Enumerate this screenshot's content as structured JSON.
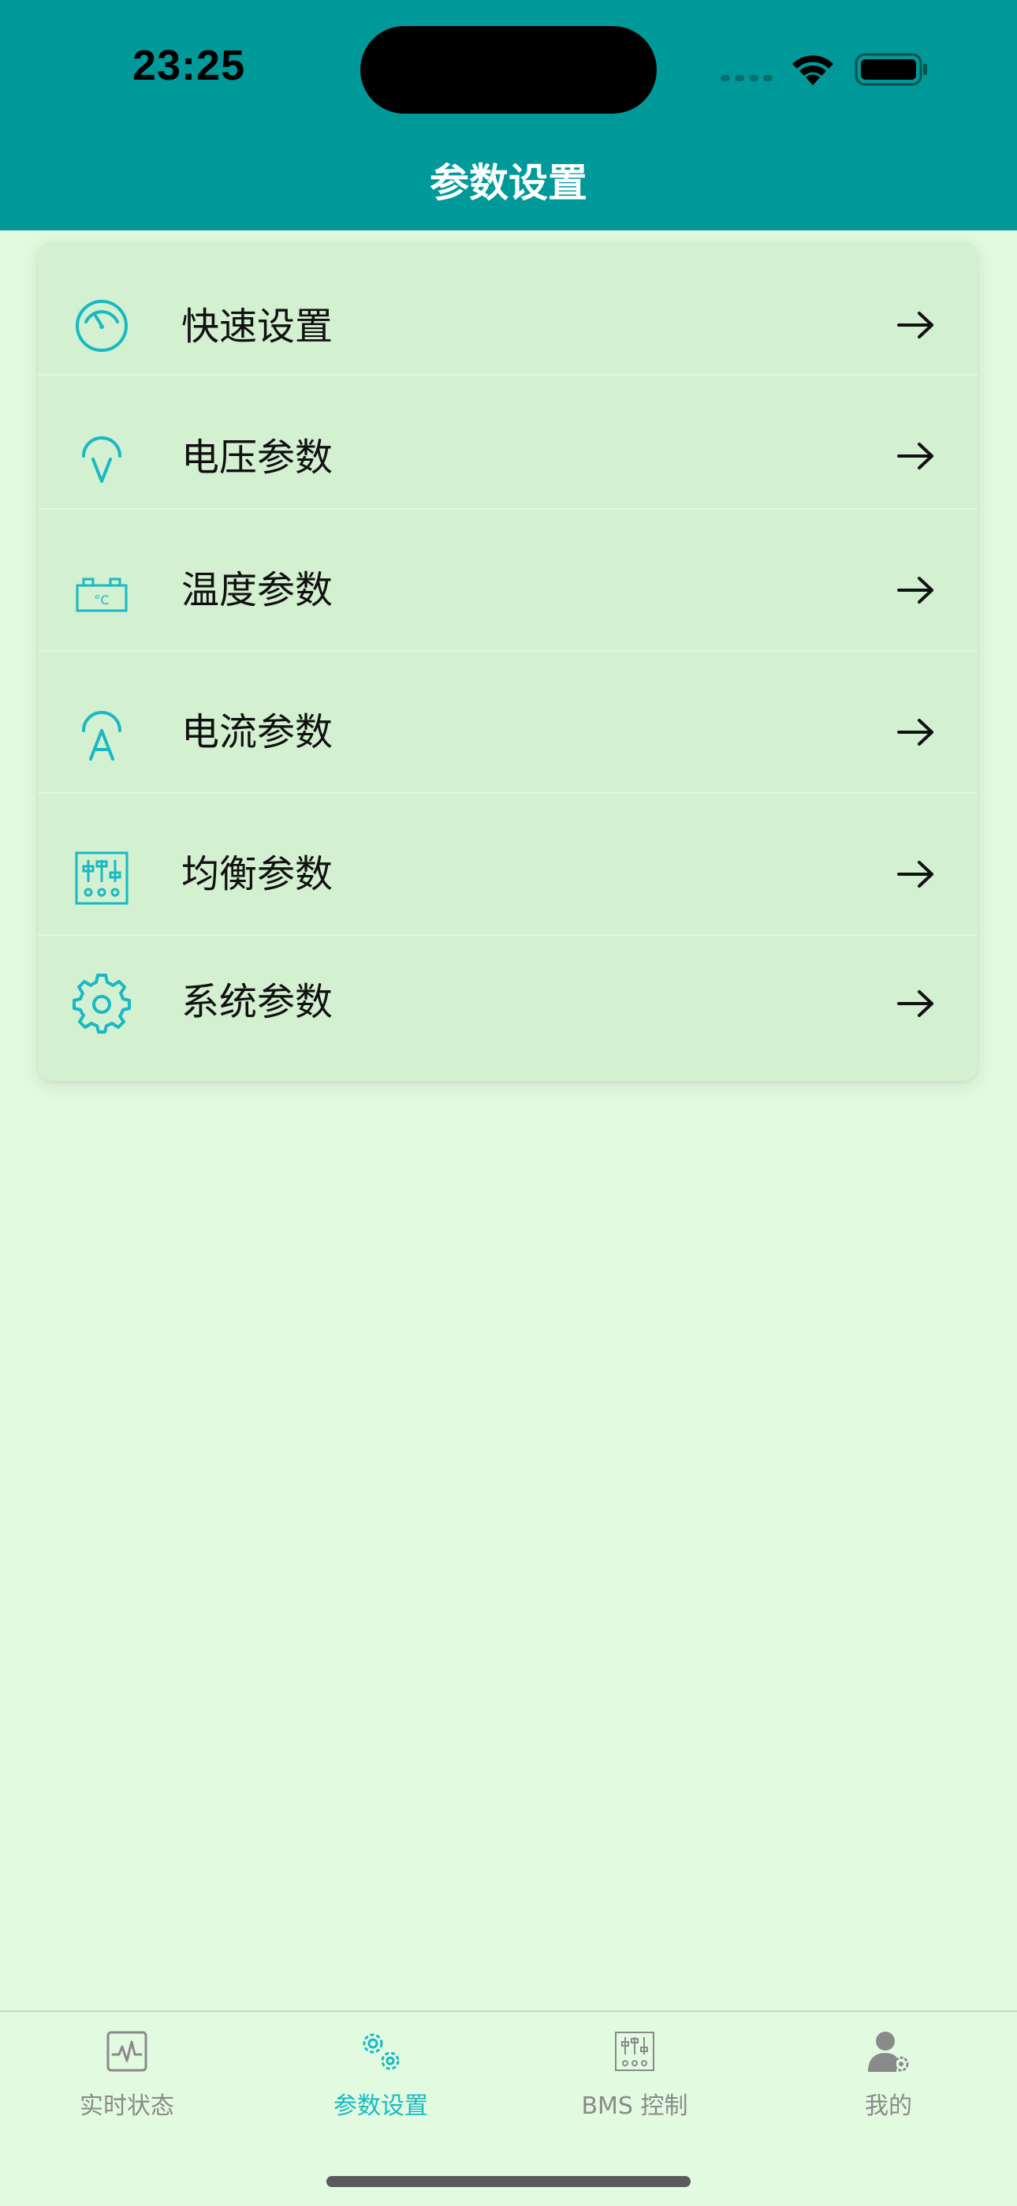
{
  "status_bar": {
    "time": "23:25"
  },
  "header": {
    "title": "参数设置"
  },
  "menu": {
    "items": [
      {
        "label": "快速设置",
        "icon": "speedometer-icon"
      },
      {
        "label": "电压参数",
        "icon": "voltage-icon"
      },
      {
        "label": "温度参数",
        "icon": "temperature-icon"
      },
      {
        "label": "电流参数",
        "icon": "current-icon"
      },
      {
        "label": "均衡参数",
        "icon": "balance-icon"
      },
      {
        "label": "系统参数",
        "icon": "gear-icon"
      }
    ]
  },
  "tab_bar": {
    "tabs": [
      {
        "label": "实时状态",
        "icon": "waveform-icon",
        "active": false
      },
      {
        "label": "参数设置",
        "icon": "gears-icon",
        "active": true
      },
      {
        "label": "BMS 控制",
        "icon": "control-panel-icon",
        "active": false
      },
      {
        "label": "我的",
        "icon": "user-settings-icon",
        "active": false
      }
    ]
  },
  "colors": {
    "header_bg": "#009999",
    "page_bg": "#e2fbe0",
    "card_bg": "#d3f0d1",
    "accent": "#19b9c4",
    "inactive": "#8a8a8a"
  }
}
